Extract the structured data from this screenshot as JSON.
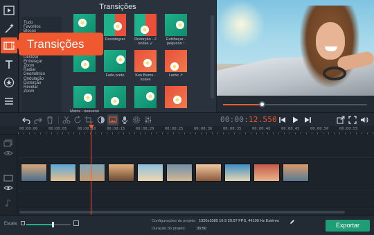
{
  "callout": {
    "label": "Transições"
  },
  "transitions_panel": {
    "title": "Transições",
    "categories": [
      "Tudo",
      "Favoritos",
      "Blocos",
      "Rotação",
      "Íris",
      "Ruído",
      "Dissolver",
      "Apagar",
      "Deslizar",
      "Entrelaçar",
      "Zoom",
      "Radial",
      "Geométrico",
      "Ondulação",
      "Distorção",
      "Revelar",
      "Zoom"
    ],
    "items": [
      {
        "label": "",
        "thumb": "green"
      },
      {
        "label": "Desintegrar",
        "thumb": "mix"
      },
      {
        "label": "Distorção - 2 ondas ↙",
        "thumb": "mix"
      },
      {
        "label": "Estilhaçar - pequeno ↑",
        "thumb": "green"
      },
      {
        "label": "",
        "thumb": "green"
      },
      {
        "label": "Fade preto",
        "thumb": "green"
      },
      {
        "label": "Ken Burns - suave",
        "thumb": "red"
      },
      {
        "label": "Lente ↗",
        "thumb": "red"
      },
      {
        "label": "Matrix - pequeno",
        "thumb": "green"
      },
      {
        "label": "",
        "thumb": "green"
      },
      {
        "label": "",
        "thumb": "green"
      },
      {
        "label": "",
        "thumb": "red"
      },
      {
        "label": "",
        "thumb": "red"
      },
      {
        "label": "",
        "thumb": "green"
      }
    ]
  },
  "toolbar": {
    "undo": "undo-icon",
    "redo": "redo-icon",
    "delete": "trash-icon",
    "time_static": "00:00:",
    "time_accent": "12.550"
  },
  "preview": {
    "progress": 0.27
  },
  "ruler": {
    "labels": [
      "00:00:00",
      "00:00:05",
      "00:00:10",
      "00:00:15",
      "00:00:20",
      "00:00:25",
      "00:00:30",
      "00:00:35",
      "00:00:40",
      "00:00:45",
      "00:00:50",
      "00:00:55"
    ]
  },
  "timeline": {
    "clips": 10
  },
  "bottom": {
    "scale_label": "Escala:",
    "scale_value": 0.6,
    "proj_settings_label": "Configurações do projeto:",
    "proj_settings_value": "1920x1080 16:9 29.97 FPS, 44100 Hz Estéreo",
    "duration_label": "Duração do projeto:",
    "duration_value": "00:50",
    "export_label": "Exportar"
  },
  "colors": {
    "accent": "#f0582f",
    "green": "#1f9d74",
    "panel": "#2a333d"
  }
}
